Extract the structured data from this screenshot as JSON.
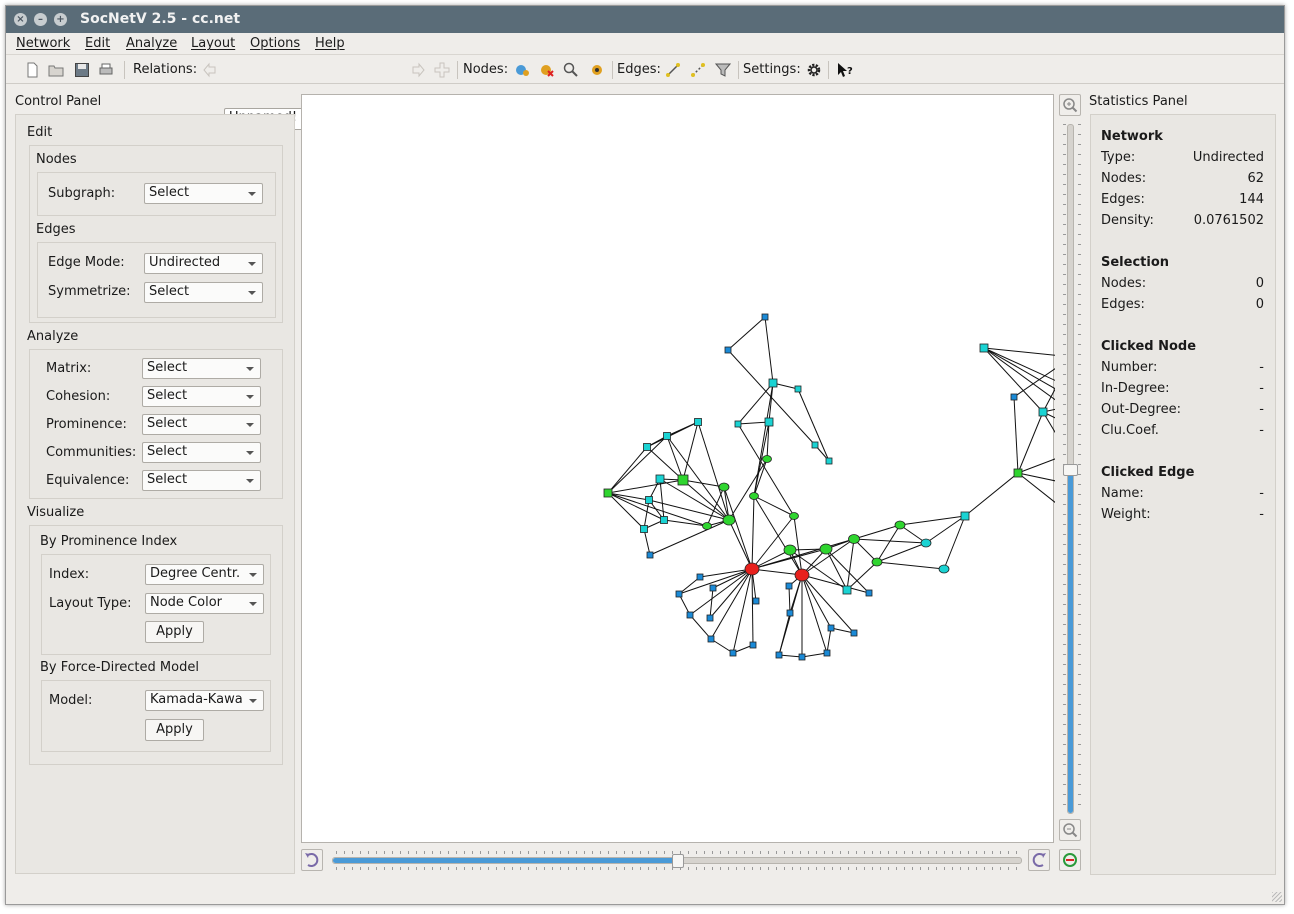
{
  "window": {
    "title": "SocNetV 2.5 - cc.net"
  },
  "menubar": {
    "items": [
      "Network",
      "Edit",
      "Analyze",
      "Layout",
      "Options",
      "Help"
    ]
  },
  "toolbar": {
    "relations_label": "Relations:",
    "relation_value": "Unnamed!",
    "nodes_label": "Nodes:",
    "edges_label": "Edges:",
    "settings_label": "Settings:"
  },
  "control_panel": {
    "title": "Control Panel",
    "edit": {
      "title": "Edit",
      "nodes_title": "Nodes",
      "subgraph_label": "Subgraph:",
      "subgraph_value": "Select",
      "edges_title": "Edges",
      "edge_mode_label": "Edge Mode:",
      "edge_mode_value": "Undirected",
      "symmetrize_label": "Symmetrize:",
      "symmetrize_value": "Select"
    },
    "analyze": {
      "title": "Analyze",
      "rows": [
        {
          "label": "Matrix:",
          "value": "Select"
        },
        {
          "label": "Cohesion:",
          "value": "Select"
        },
        {
          "label": "Prominence:",
          "value": "Select"
        },
        {
          "label": "Communities:",
          "value": "Select"
        },
        {
          "label": "Equivalence:",
          "value": "Select"
        }
      ]
    },
    "visualize": {
      "title": "Visualize",
      "prominence_title": "By Prominence Index",
      "index_label": "Index:",
      "index_value": "Degree Centr.",
      "layout_type_label": "Layout Type:",
      "layout_type_value": "Node Color",
      "apply_label": "Apply",
      "force_title": "By Force-Directed Model",
      "model_label": "Model:",
      "model_value": "Kamada-Kawa",
      "apply2_label": "Apply"
    }
  },
  "statistics": {
    "title": "Statistics Panel",
    "network": {
      "heading": "Network",
      "type_label": "Type:",
      "type_value": "Undirected",
      "nodes_label": "Nodes:",
      "nodes_value": "62",
      "edges_label": "Edges:",
      "edges_value": "144",
      "density_label": "Density:",
      "density_value": "0.0761502"
    },
    "selection": {
      "heading": "Selection",
      "nodes_label": "Nodes:",
      "nodes_value": "0",
      "edges_label": "Edges:",
      "edges_value": "0"
    },
    "clicked_node": {
      "heading": "Clicked Node",
      "number_label": "Number:",
      "number_value": "-",
      "indegree_label": "In-Degree:",
      "indegree_value": "-",
      "outdegree_label": "Out-Degree:",
      "outdegree_value": "-",
      "cluc_label": "Clu.Coef.",
      "cluc_value": "-"
    },
    "clicked_edge": {
      "heading": "Clicked Edge",
      "name_label": "Name:",
      "name_value": "-",
      "weight_label": "Weight:",
      "weight_value": "-"
    }
  },
  "zoom": {
    "vertical_level": 0.5,
    "rotate_level": 0.5
  },
  "colors": {
    "accent": "#4a9ad7",
    "titlebar": "#5a6c78",
    "node_red": "#e8201c",
    "node_green": "#2fd52f",
    "node_cyan": "#1ad3d3",
    "node_blue": "#1a8ad7"
  }
}
